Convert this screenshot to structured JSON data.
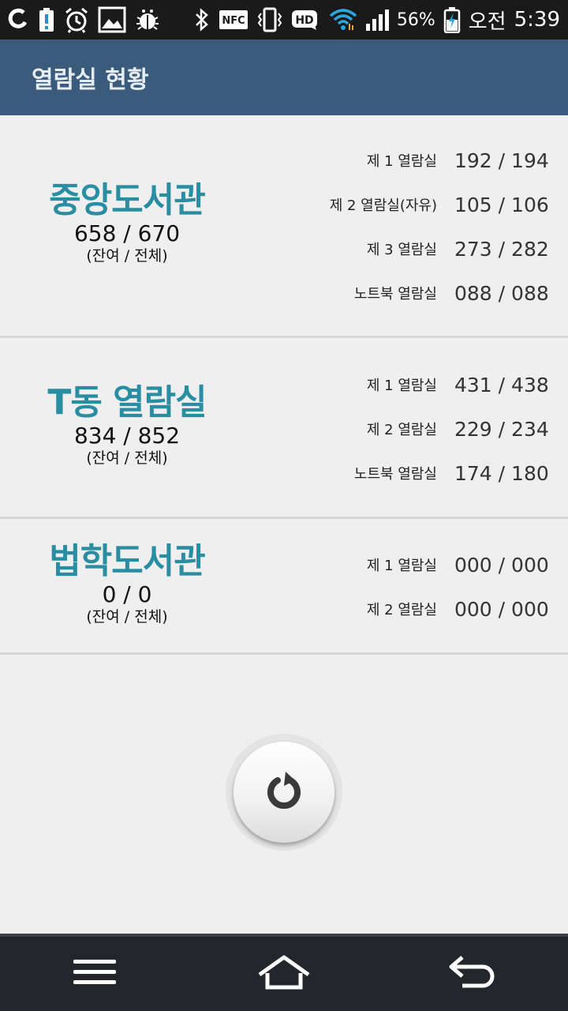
{
  "status_bar": {
    "battery_percent": "56%",
    "time_period": "오전",
    "time": "5:39",
    "left_icons": [
      "o-app-icon",
      "battery-alert-icon",
      "alarm-icon",
      "gallery-icon",
      "bug-icon"
    ],
    "right_icons": [
      "bluetooth-icon",
      "nfc-icon",
      "vibrate-icon",
      "hd-icon",
      "wifi-icon",
      "signal-icon",
      "battery-icon"
    ],
    "nfc_label": "NFC",
    "hd_label": "HD"
  },
  "app_bar": {
    "title": "열람실 현황"
  },
  "libraries": [
    {
      "name": "중앙도서관",
      "count": "658 / 670",
      "caption": "(잔여 / 전체)",
      "rooms": [
        {
          "label": "제 1 열람실",
          "value": "192 / 194"
        },
        {
          "label": "제 2 열람실(자유)",
          "value": "105 / 106"
        },
        {
          "label": "제 3 열람실",
          "value": "273 / 282"
        },
        {
          "label": "노트북 열람실",
          "value": "088 / 088"
        }
      ]
    },
    {
      "name": "T동 열람실",
      "count": "834 / 852",
      "caption": "(잔여 / 전체)",
      "rooms": [
        {
          "label": "제 1 열람실",
          "value": "431 / 438"
        },
        {
          "label": "제 2 열람실",
          "value": "229 / 234"
        },
        {
          "label": "노트북 열람실",
          "value": "174 / 180"
        }
      ]
    },
    {
      "name": "법학도서관",
      "count": "0 / 0",
      "caption": "(잔여 / 전체)",
      "rooms": [
        {
          "label": "제 1 열람실",
          "value": "000 / 000"
        },
        {
          "label": "제 2 열람실",
          "value": "000 / 000"
        }
      ]
    }
  ],
  "refresh": {
    "icon": "refresh-icon"
  },
  "nav_bar": {
    "icons": [
      "menu-icon",
      "home-icon",
      "back-icon"
    ]
  },
  "colors": {
    "app_bar": "#3a5b7c",
    "library_name": "#2a8ea3",
    "background": "#efefef",
    "nav_bar": "#23272b"
  }
}
